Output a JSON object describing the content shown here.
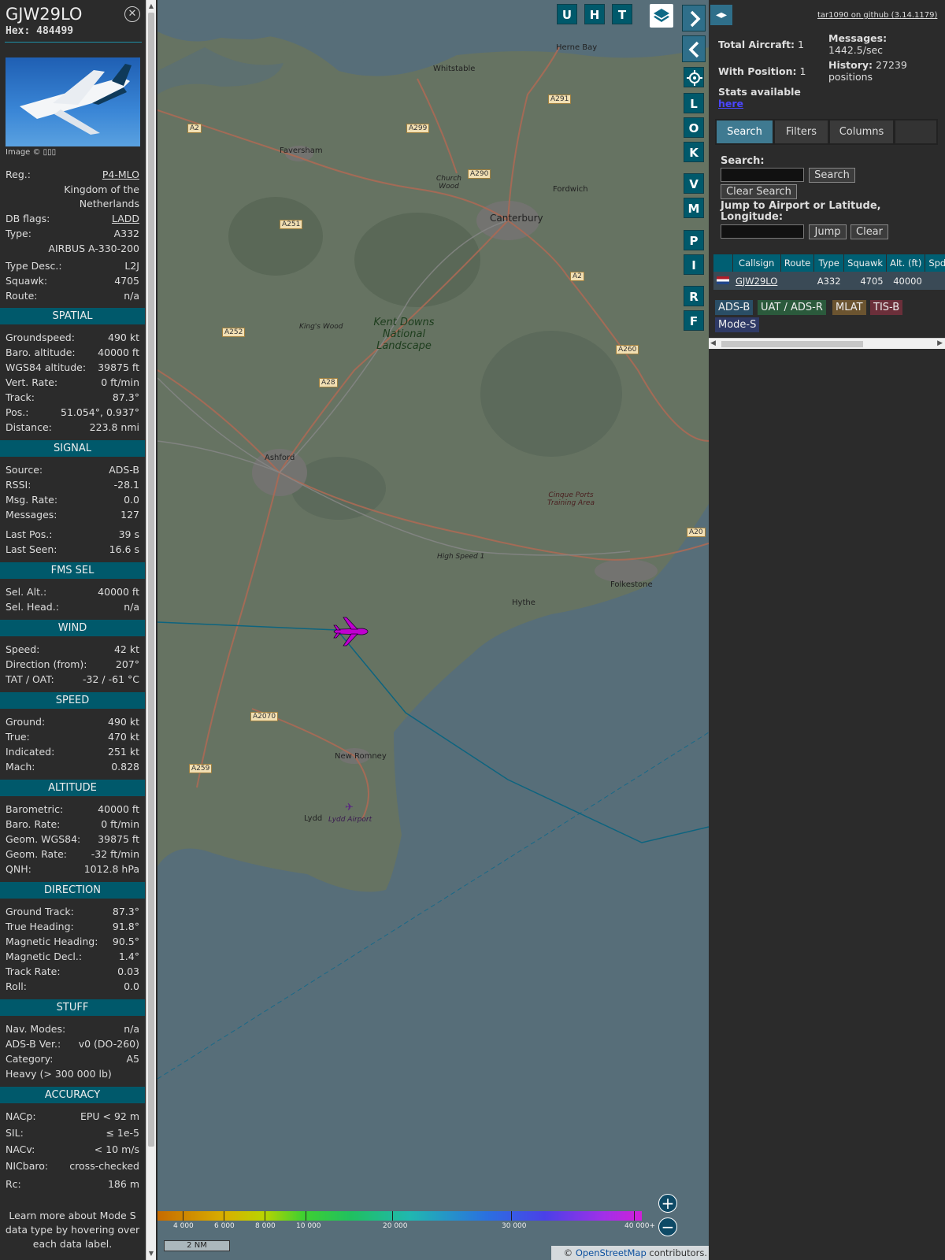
{
  "header": {
    "callsign": "GJW29LO",
    "hex_label": "Hex:",
    "hex_value": "484499",
    "photo_caption": "Image © ▯▯▯"
  },
  "details": [
    {
      "k": "Reg.:",
      "v": "P4-MLO",
      "link": true
    },
    {
      "k": "",
      "v": "Kingdom of the"
    },
    {
      "k": "",
      "v": "Netherlands"
    },
    {
      "k": "DB flags:",
      "v": "LADD",
      "link": true
    },
    {
      "k": "Type:",
      "v": "A332"
    },
    {
      "k": "",
      "v": "AIRBUS A-330-200"
    }
  ],
  "details2": [
    {
      "k": "Type Desc.:",
      "v": "L2J"
    },
    {
      "k": "Squawk:",
      "v": "4705"
    },
    {
      "k": "Route:",
      "v": "n/a"
    }
  ],
  "sections": {
    "spatial": {
      "title": "SPATIAL",
      "rows": [
        {
          "k": "Groundspeed:",
          "v": "490 kt"
        },
        {
          "k": "Baro. altitude:",
          "v": "40000 ft"
        },
        {
          "k": "WGS84 altitude:",
          "v": "39875 ft"
        },
        {
          "k": "Vert. Rate:",
          "v": "0 ft/min"
        },
        {
          "k": "Track:",
          "v": "87.3°"
        },
        {
          "k": "Pos.:",
          "v": "51.054°, 0.937°"
        },
        {
          "k": "Distance:",
          "v": "223.8 nmi"
        }
      ]
    },
    "signal": {
      "title": "SIGNAL",
      "rows": [
        {
          "k": "Source:",
          "v": "ADS-B"
        },
        {
          "k": "RSSI:",
          "v": "-28.1"
        },
        {
          "k": "Msg. Rate:",
          "v": "0.0"
        },
        {
          "k": "Messages:",
          "v": "127"
        },
        {
          "k": "Last Pos.:",
          "v": "39 s"
        },
        {
          "k": "Last Seen:",
          "v": "16.6 s"
        }
      ]
    },
    "fms": {
      "title": "FMS SEL",
      "rows": [
        {
          "k": "Sel. Alt.:",
          "v": "40000 ft"
        },
        {
          "k": "Sel. Head.:",
          "v": "n/a"
        }
      ]
    },
    "wind": {
      "title": "WIND",
      "rows": [
        {
          "k": "Speed:",
          "v": "42 kt"
        },
        {
          "k": "Direction (from):",
          "v": "207°"
        },
        {
          "k": "TAT / OAT:",
          "v": "-32 / -61 °C"
        }
      ]
    },
    "speed": {
      "title": "SPEED",
      "rows": [
        {
          "k": "Ground:",
          "v": "490 kt"
        },
        {
          "k": "True:",
          "v": "470 kt"
        },
        {
          "k": "Indicated:",
          "v": "251 kt"
        },
        {
          "k": "Mach:",
          "v": "0.828"
        }
      ]
    },
    "altitude": {
      "title": "ALTITUDE",
      "rows": [
        {
          "k": "Barometric:",
          "v": "40000 ft"
        },
        {
          "k": "Baro. Rate:",
          "v": "0 ft/min"
        },
        {
          "k": "Geom. WGS84:",
          "v": "39875 ft"
        },
        {
          "k": "Geom. Rate:",
          "v": "-32 ft/min"
        },
        {
          "k": "QNH:",
          "v": "1012.8 hPa"
        }
      ]
    },
    "direction": {
      "title": "DIRECTION",
      "rows": [
        {
          "k": "Ground Track:",
          "v": "87.3°"
        },
        {
          "k": "True Heading:",
          "v": "91.8°"
        },
        {
          "k": "Magnetic Heading:",
          "v": "90.5°"
        },
        {
          "k": "Magnetic Decl.:",
          "v": "1.4°"
        },
        {
          "k": "Track Rate:",
          "v": "0.03"
        },
        {
          "k": "Roll:",
          "v": "0.0"
        }
      ]
    },
    "stuff": {
      "title": "STUFF",
      "rows": [
        {
          "k": "Nav. Modes:",
          "v": "n/a"
        },
        {
          "k": "ADS-B Ver.:",
          "v": "v0 (DO-260)"
        },
        {
          "k": "Category:",
          "v": "A5"
        },
        {
          "k": "Heavy (> 300 000 lb)",
          "v": ""
        }
      ]
    },
    "accuracy": {
      "title": "ACCURACY",
      "rows": [
        {
          "k": "NACp:",
          "v": "EPU < 92 m"
        },
        {
          "k": "SIL:",
          "v": "≤ 1e-5"
        },
        {
          "k": "NACv:",
          "v": "< 10 m/s"
        },
        {
          "k": "NICbaro:",
          "v": "cross-checked"
        },
        {
          "k": "Rc:",
          "v": "186 m"
        }
      ]
    }
  },
  "footnote": "Learn more about Mode S data type by hovering over each data label.",
  "map": {
    "top_buttons": [
      "U",
      "H",
      "T"
    ],
    "side_buttons": [
      "L",
      "O",
      "K",
      "V",
      "M",
      "P",
      "I",
      "R",
      "F"
    ],
    "places": {
      "herne_bay": "Herne Bay",
      "whitstable": "Whitstable",
      "faversham": "Faversham",
      "canterbury": "Canterbury",
      "fordwich": "Fordwich",
      "church_wood": "Church Wood",
      "kent_downs": "Kent Downs National Landscape",
      "kings_wood": "King's Wood",
      "ashford": "Ashford",
      "hythe": "Hythe",
      "folkestone": "Folkestone",
      "cinque": "Cinque Ports Training Area",
      "new_romney": "New Romney",
      "lydd": "Lydd",
      "lydd_airport": "Lydd Airport",
      "high_speed": "High Speed 1"
    },
    "roads": [
      "A2",
      "A299",
      "A291",
      "A290",
      "A251",
      "A2",
      "A252",
      "A28",
      "A260",
      "A20",
      "A2070",
      "A259"
    ],
    "legend_ticks": [
      "4 000",
      "6 000",
      "8 000",
      "10 000",
      "20 000",
      "30 000",
      "40 000+"
    ],
    "scale": "2 NM",
    "attribution_prefix": "© ",
    "attribution_link": "OpenStreetMap",
    "attribution_suffix": " contributors."
  },
  "right": {
    "github": "tar1090 on github (3.14.1179)",
    "total_aircraft_label": "Total Aircraft:",
    "total_aircraft": "1",
    "with_position_label": "With Position:",
    "with_position": "1",
    "messages_label": "Messages:",
    "messages": "1442.5/sec",
    "history_label": "History:",
    "history": "27239 positions",
    "stats_label": "Stats available",
    "stats_link": "here",
    "tabs": [
      "Search",
      "Filters",
      "Columns"
    ],
    "search_label": "Search:",
    "search_btn": "Search",
    "clear_search_btn": "Clear Search",
    "jump_label": "Jump to Airport or Latitude, Longitude:",
    "jump_btn": "Jump",
    "clear_btn": "Clear",
    "table_headers": [
      "",
      "Callsign",
      "Route",
      "Type",
      "Squawk",
      "Alt. (ft)",
      "Spd"
    ],
    "table_rows": [
      {
        "callsign": "GJW29LO",
        "route": "",
        "type": "A332",
        "squawk": "4705",
        "alt": "40000"
      }
    ],
    "badges": [
      "ADS-B",
      "UAT / ADS-R",
      "MLAT",
      "TIS-B",
      "Mode-S"
    ]
  },
  "colors": {
    "accent": "#00596b",
    "track": "#0e6a86",
    "aircraft": "#c000d0"
  }
}
